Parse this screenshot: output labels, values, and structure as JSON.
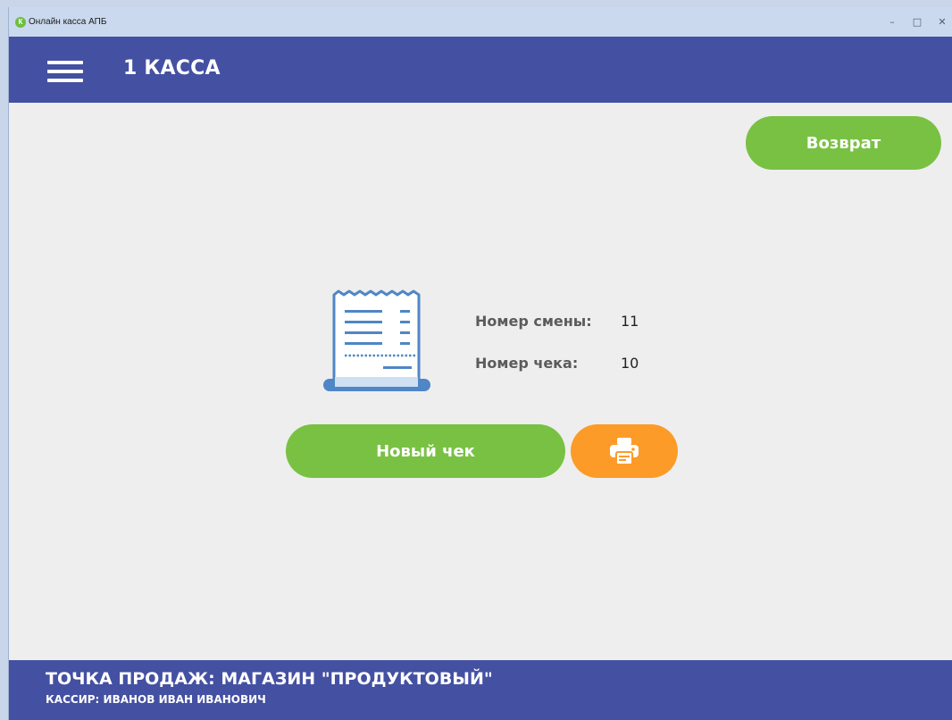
{
  "window": {
    "title": "Онлайн касса АПБ",
    "logo_letter": "К",
    "controls": {
      "minimize": "–",
      "maximize": "□",
      "close": "✕"
    }
  },
  "header": {
    "title": "1 КАССА",
    "menu_icon": "hamburger-menu-icon"
  },
  "actions": {
    "return_label": "Возврат",
    "new_receipt_label": "Новый чек",
    "print_icon": "printer-icon"
  },
  "shift_info": {
    "shift_label": "Номер смены:",
    "shift_value": "11",
    "receipt_label": "Номер чека:",
    "receipt_value": "10"
  },
  "footer": {
    "point_of_sale": "ТОЧКА ПРОДАЖ:  МАГАЗИН \"ПРОДУКТОВЫЙ\"",
    "cashier": "КАССИР: ИВАНОВ ИВАН ИВАНОВИЧ"
  },
  "colors": {
    "header_bg": "#4450a2",
    "primary_green": "#79c143",
    "print_orange": "#fd9b28",
    "content_bg": "#eeeeee",
    "receipt_blue": "#4f86c6"
  }
}
